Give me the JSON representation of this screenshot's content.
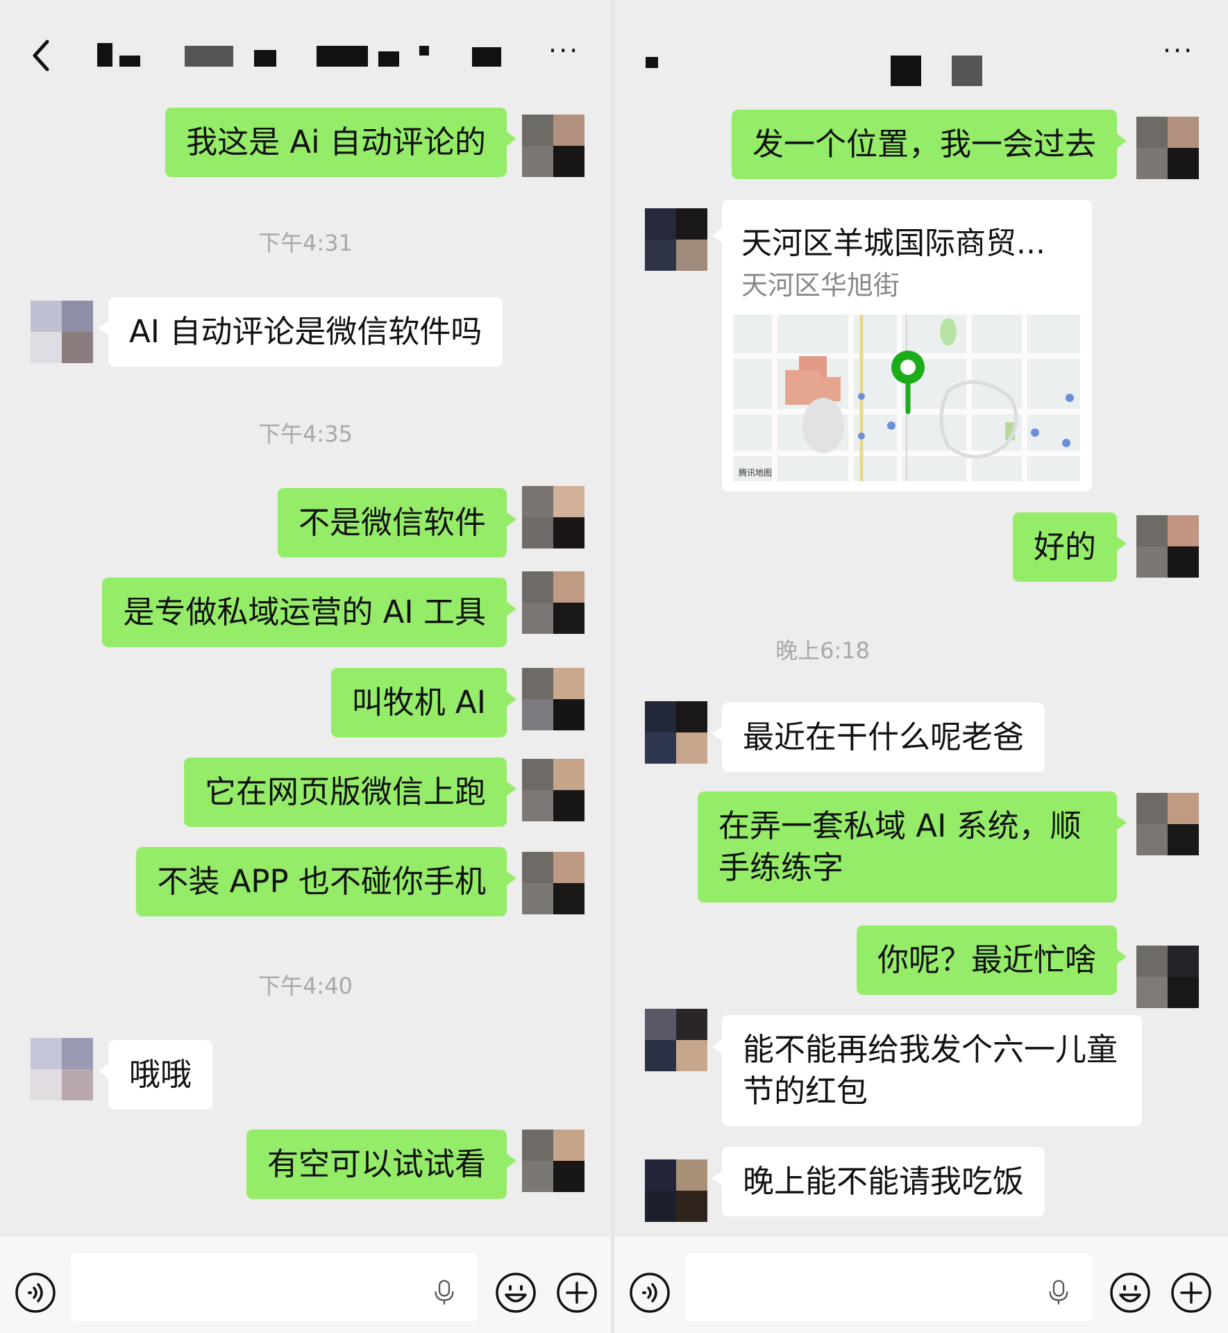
{
  "left": {
    "header": {
      "title": "",
      "more": "···"
    },
    "messages": [
      {
        "from": "me",
        "text": "我这是 Ai 自动评论的"
      },
      {
        "type": "time",
        "text": "下午4:31"
      },
      {
        "from": "other",
        "text": "AI 自动评论是微信软件吗"
      },
      {
        "type": "time",
        "text": "下午4:35"
      },
      {
        "from": "me",
        "text": "不是微信软件"
      },
      {
        "from": "me",
        "text": "是专做私域运营的 AI 工具"
      },
      {
        "from": "me",
        "text": "叫牧机 AI"
      },
      {
        "from": "me",
        "text": "它在网页版微信上跑"
      },
      {
        "from": "me",
        "text": "不装 APP 也不碰你手机"
      },
      {
        "type": "time",
        "text": "下午4:40"
      },
      {
        "from": "other",
        "text": "哦哦"
      },
      {
        "from": "me",
        "text": "有空可以试试看"
      }
    ],
    "input": {
      "value": ""
    }
  },
  "right": {
    "header": {
      "title": "",
      "more": "···"
    },
    "messages": [
      {
        "from": "me",
        "text": "发一个位置，我一会过去"
      },
      {
        "from": "other",
        "type": "location",
        "title": "天河区羊城国际商贸...",
        "subtitle": "天河区华旭街",
        "map_label": "腾讯地图"
      },
      {
        "from": "me",
        "text": "好的"
      },
      {
        "type": "time",
        "text": "晚上6:18"
      },
      {
        "from": "other",
        "text": "最近在干什么呢老爸"
      },
      {
        "from": "me",
        "text": "在弄一套私域 AI 系统，顺手练练字"
      },
      {
        "from": "me",
        "text": "你呢？最近忙啥"
      },
      {
        "from": "other",
        "text": "能不能再给我发个六一儿童节的红包"
      },
      {
        "from": "other",
        "text": "晚上能不能请我吃饭"
      }
    ],
    "input": {
      "value": ""
    }
  },
  "icons": [
    "back-arrow-icon",
    "more-icon",
    "voice-mode-icon",
    "microphone-icon",
    "emoji-icon",
    "plus-icon",
    "map-pin-icon"
  ],
  "colors": {
    "background": "#ededed",
    "sent_bubble": "#95ec69",
    "received_bubble": "#ffffff",
    "timestamp": "#a8a8a8",
    "map_pin": "#1aad19"
  }
}
